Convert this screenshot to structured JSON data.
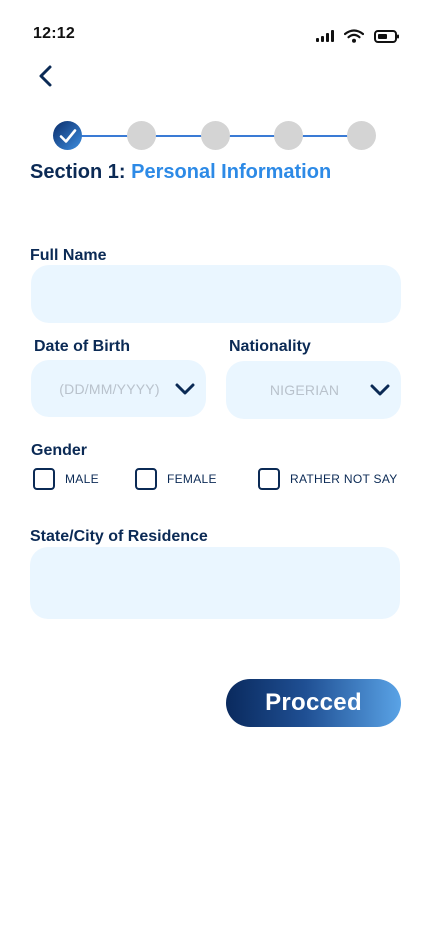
{
  "status_bar": {
    "time": "12:12",
    "icons": [
      "signal-icon",
      "wifi-icon",
      "battery-icon"
    ]
  },
  "navigation": {
    "back_icon": "chevron-left-icon"
  },
  "stepper": {
    "total_steps": 5,
    "completed_steps": 1,
    "current_step": 1
  },
  "section": {
    "prefix": "Section 1:",
    "name": "Personal Information"
  },
  "form": {
    "full_name": {
      "label": "Full Name",
      "value": "",
      "placeholder": ""
    },
    "date_of_birth": {
      "label": "Date of Birth",
      "placeholder": "(DD/MM/YYYY)"
    },
    "nationality": {
      "label": "Nationality",
      "selected": "NIGERIAN"
    },
    "gender": {
      "label": "Gender",
      "options": [
        {
          "label": "MALE",
          "checked": false
        },
        {
          "label": "FEMALE",
          "checked": false
        },
        {
          "label": "RATHER NOT SAY",
          "checked": false
        }
      ]
    },
    "residence": {
      "label": "State/City of Residence",
      "value": "",
      "placeholder": ""
    }
  },
  "actions": {
    "proceed_label": "Procced"
  },
  "colors": {
    "primary_dark": "#0b2a55",
    "accent_blue": "#2d8ae6",
    "field_bg": "#eaf6ff",
    "step_inactive": "#d4d4d4"
  }
}
